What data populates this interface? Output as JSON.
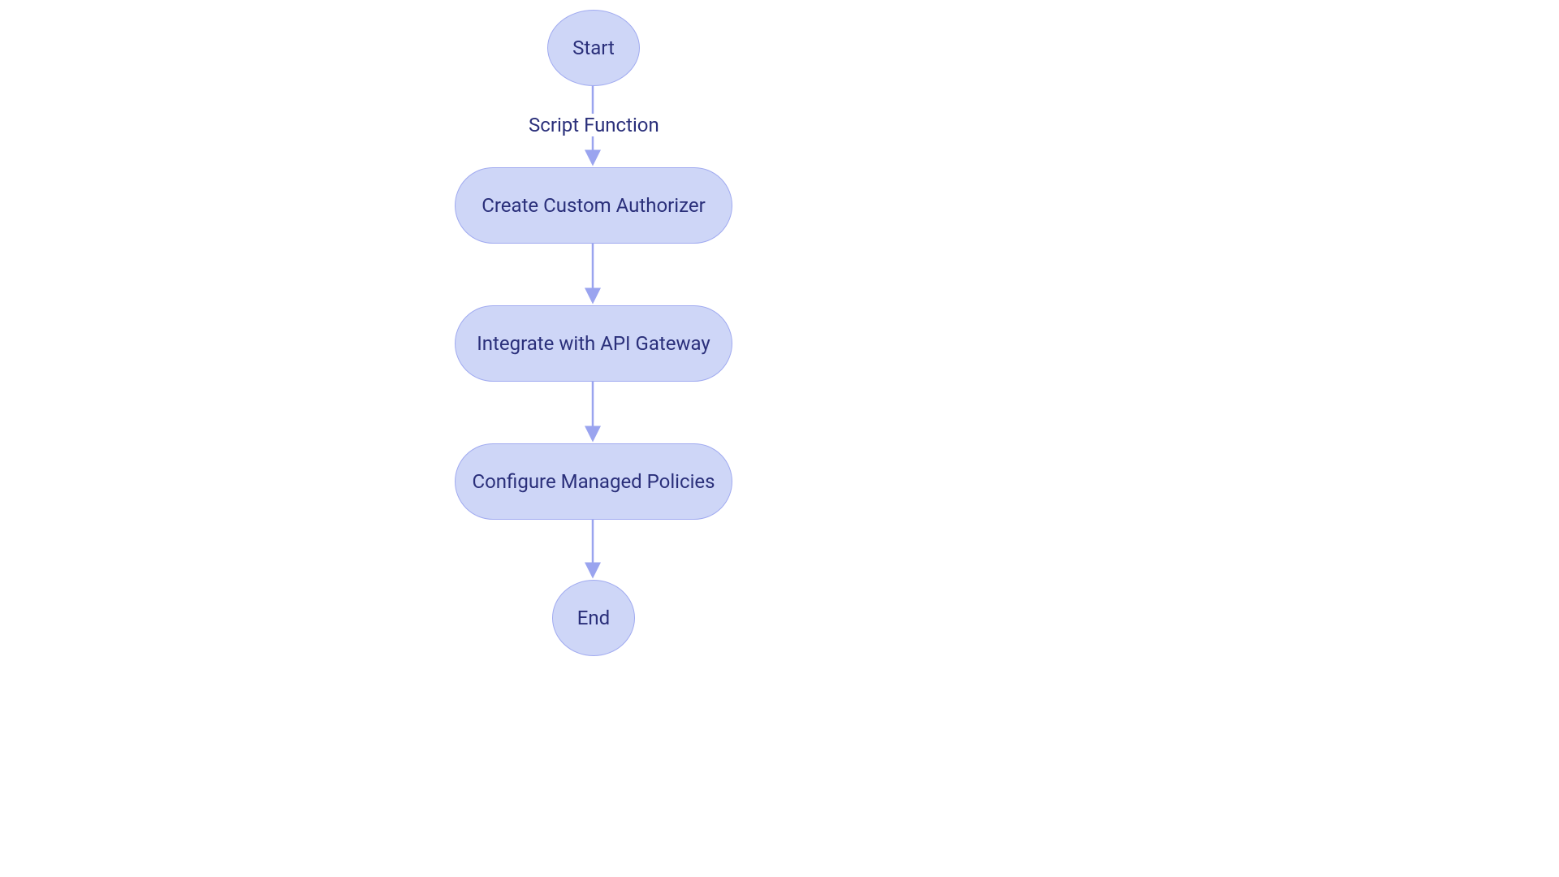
{
  "colors": {
    "node_fill": "#ced6f7",
    "node_stroke": "#a0aaf0",
    "text": "#2a2f7a",
    "arrow": "#9aa4ef"
  },
  "nodes": {
    "start": {
      "label": "Start"
    },
    "create": {
      "label": "Create Custom Authorizer"
    },
    "integrate": {
      "label": "Integrate with API Gateway"
    },
    "configure": {
      "label": "Configure Managed Policies"
    },
    "end": {
      "label": "End"
    }
  },
  "edges": {
    "start_to_create": {
      "label": "Script Function"
    }
  }
}
